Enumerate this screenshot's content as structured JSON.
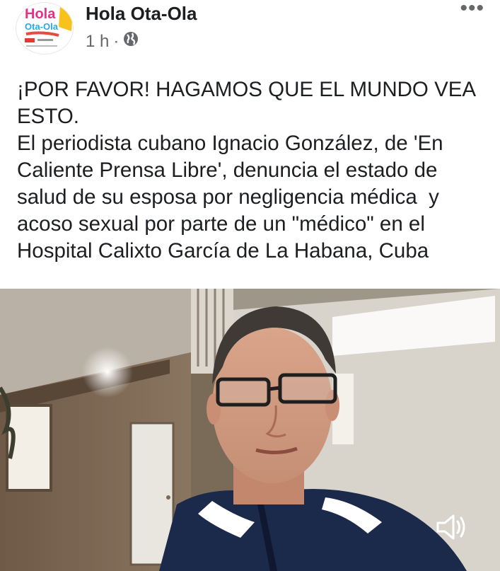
{
  "post": {
    "page_name": "Hola Ota-Ola",
    "time": "1 h",
    "separator": "·",
    "more_label": "•••",
    "text": "¡POR FAVOR! HAGAMOS QUE EL MUNDO VEA ESTO.\nEl periodista cubano Ignacio González, de 'En Caliente Prensa Libre', denuncia el estado de salud de su esposa por negligencia médica  y acoso sexual por parte de un \"médico\" en el Hospital Calixto García de La Habana, Cuba"
  },
  "avatar": {
    "logo_line1": "Hola",
    "logo_line2": "Ota-Ola"
  },
  "icons": {
    "privacy": "globe-icon",
    "more": "more-options-icon",
    "sound": "speaker-icon"
  },
  "colors": {
    "text": "#1c1e21",
    "meta": "#65676b",
    "shirt": "#1b2a4a"
  }
}
